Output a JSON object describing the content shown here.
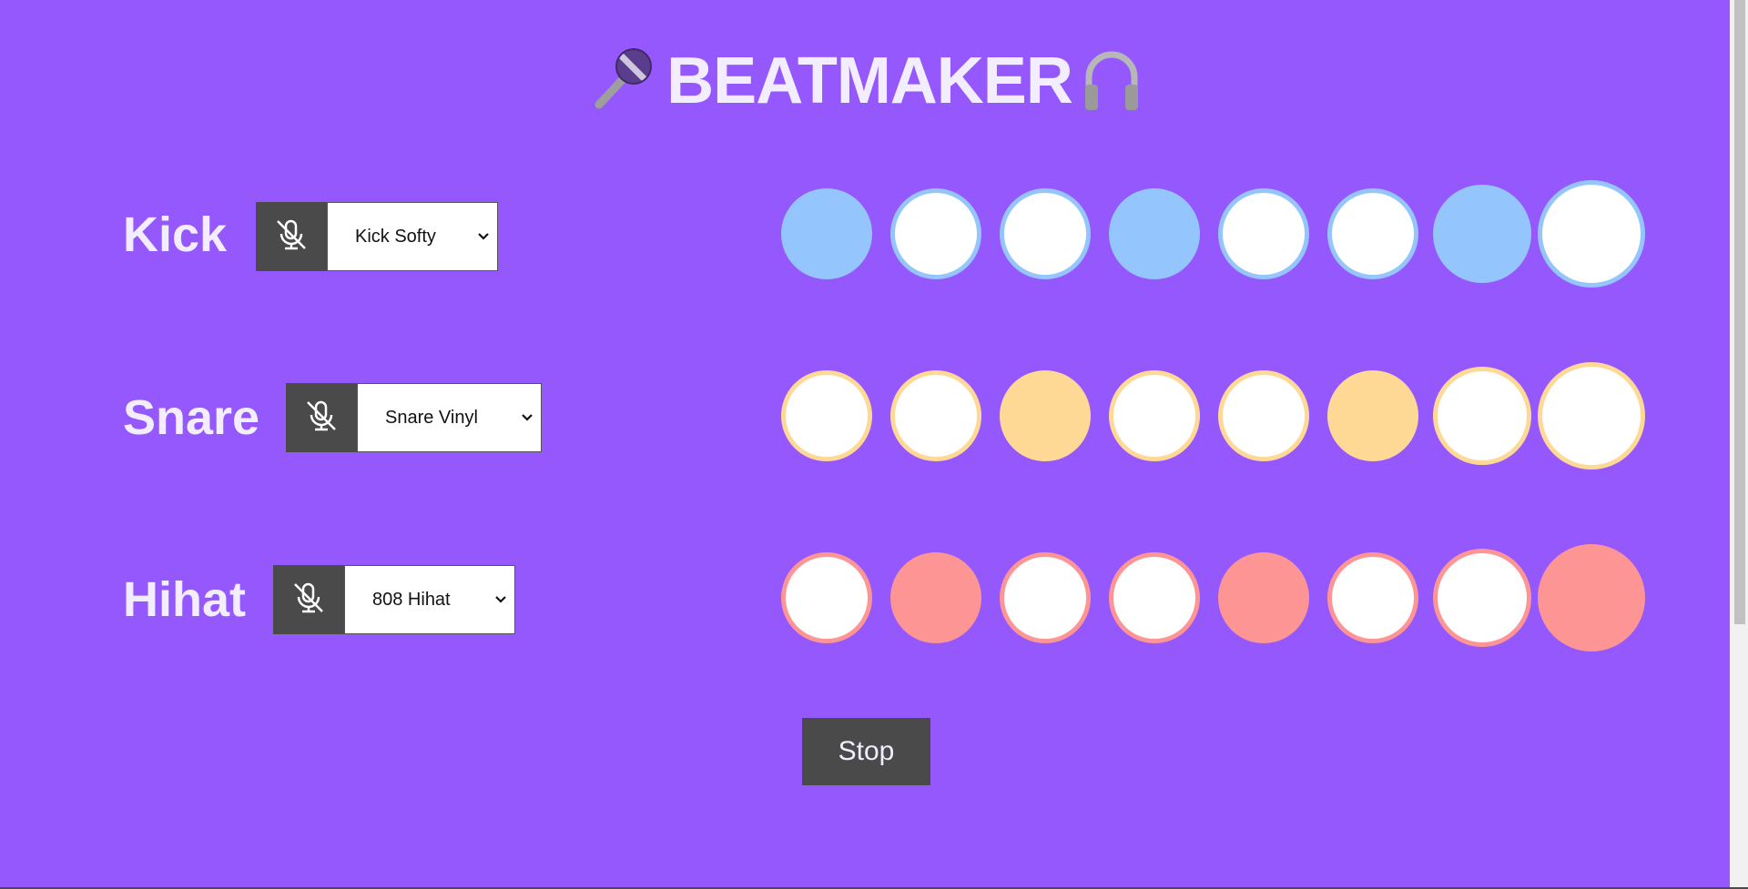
{
  "header": {
    "title": "BEATMAKER",
    "left_icon": "microphone-icon",
    "right_icon": "headphones-icon"
  },
  "tracks": [
    {
      "name": "Kick",
      "mute_icon": "microphone-muted-icon",
      "selected_sound": "Kick Softy",
      "pad_color": "#95c5fd",
      "pads_active": [
        true,
        false,
        false,
        true,
        false,
        false,
        true,
        false
      ]
    },
    {
      "name": "Snare",
      "mute_icon": "microphone-muted-icon",
      "selected_sound": "Snare Vinyl",
      "pad_color": "#fed996",
      "pads_active": [
        false,
        false,
        true,
        false,
        false,
        true,
        false,
        false
      ]
    },
    {
      "name": "Hihat",
      "mute_icon": "microphone-muted-icon",
      "selected_sound": "808 Hihat",
      "pad_color": "#fd9595",
      "pads_active": [
        false,
        true,
        false,
        false,
        true,
        false,
        false,
        true
      ]
    }
  ],
  "controls": {
    "stop_label": "Stop"
  },
  "colors": {
    "background": "#9558fd",
    "button_dark": "#4a4a4a",
    "text_light": "#f3eeff"
  }
}
